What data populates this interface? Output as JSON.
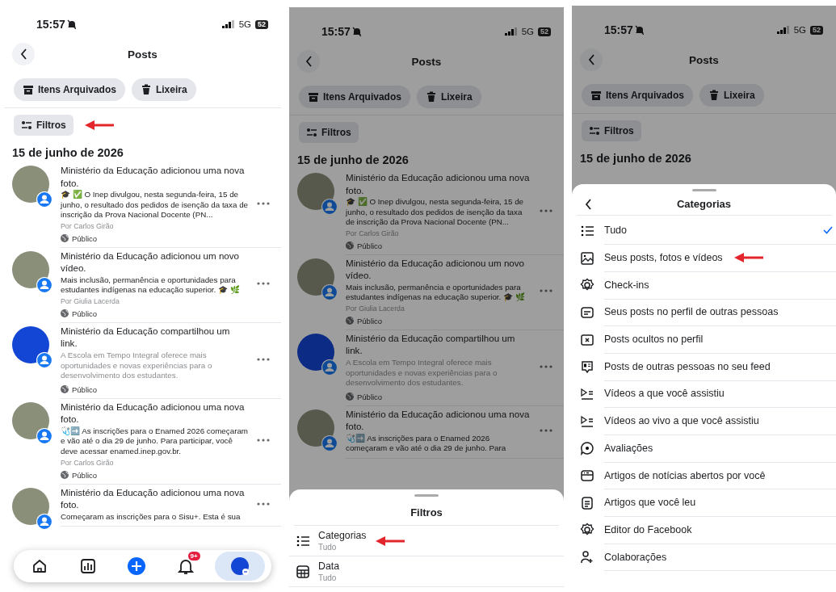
{
  "panels": [
    {
      "status": {
        "time": "15:57",
        "network": "5G",
        "battery": "52"
      },
      "header": {
        "title": "Posts"
      },
      "chips": [
        {
          "label": "Itens Arquivados"
        },
        {
          "label": "Lixeira"
        }
      ],
      "filter_button": {
        "label": "Filtros",
        "arrow": true
      },
      "date": "15 de junho de 2026",
      "posts": [
        {
          "kind": "post",
          "title": "Ministério da Educação adicionou uma nova foto.",
          "body": "🎓 ✅ O Inep divulgou, nesta segunda-feira, 15 de junho, o resultado dos pedidos de isenção da taxa de inscrição da Prova Nacional Docente (PN...",
          "author": "Por Carlos Girão",
          "audience": "Público"
        },
        {
          "kind": "post",
          "title": "Ministério da Educação adicionou um novo vídeo.",
          "body": "Mais inclusão, permanência e oportunidades para estudantes indígenas na educação superior. 🎓 🌿",
          "author": "Por Giulia Lacerda",
          "audience": "Público"
        },
        {
          "kind": "link",
          "title": "Ministério da Educação compartilhou um link.",
          "body": "A Escola em Tempo Integral oferece mais oportunidades e novas experiências para o desenvolvimento dos estudantes.",
          "audience": "Público"
        },
        {
          "kind": "post",
          "title": "Ministério da Educação adicionou uma nova foto.",
          "body": "🩺➡️ As inscrições para o Enamed 2026 começaram e vão até o dia 29 de junho. Para participar, você deve acessar enamed.inep.gov.br.",
          "author": "Por Carlos Girão",
          "audience": "Público"
        },
        {
          "kind": "post",
          "title": "Ministério da Educação adicionou uma nova foto.",
          "body": "Começaram as inscrições para o Sisu+. Esta é sua"
        }
      ],
      "nav": [
        {
          "selected": false
        },
        {
          "selected": false
        },
        {
          "selected": false
        },
        {
          "selected": false,
          "badge": "9+"
        },
        {
          "selected": true
        }
      ]
    },
    {
      "status": {
        "time": "15:57",
        "network": "5G",
        "battery": "52"
      },
      "header": {
        "title": "Posts"
      },
      "chips": [
        {
          "label": "Itens Arquivados"
        },
        {
          "label": "Lixeira"
        }
      ],
      "filter_button": {
        "label": "Filtros",
        "arrow": false
      },
      "date": "15 de junho de 2026",
      "posts": [
        {
          "kind": "post",
          "title": "Ministério da Educação adicionou uma nova foto.",
          "body": "🎓 ✅ O Inep divulgou, nesta segunda-feira, 15 de junho, o resultado dos pedidos de isenção da taxa de inscrição da Prova Nacional Docente (PN...",
          "author": "Por Carlos Girão",
          "audience": "Público"
        },
        {
          "kind": "post",
          "title": "Ministério da Educação adicionou um novo vídeo.",
          "body": "Mais inclusão, permanência e oportunidades para estudantes indígenas na educação superior. 🎓 🌿",
          "author": "Por Giulia Lacerda",
          "audience": "Público"
        },
        {
          "kind": "link",
          "title": "Ministério da Educação compartilhou um link.",
          "body": "A Escola em Tempo Integral oferece mais oportunidades e novas experiências para o desenvolvimento dos estudantes.",
          "audience": "Público"
        },
        {
          "kind": "post",
          "title": "Ministério da Educação adicionou uma nova foto.",
          "body": "🩺➡️ As inscrições para o Enamed 2026 começaram e vão até o dia 29 de junho. Para"
        }
      ],
      "sheet": {
        "kind": "filters",
        "title": "Filtros",
        "options": [
          {
            "label": "Categorias",
            "value": "Tudo",
            "arrow": true
          },
          {
            "label": "Data",
            "value": "Tudo",
            "arrow": false
          }
        ]
      }
    },
    {
      "status": {
        "time": "15:57",
        "network": "5G",
        "battery": "52"
      },
      "header": {
        "title": "Posts"
      },
      "chips": [
        {
          "label": "Itens Arquivados"
        },
        {
          "label": "Lixeira"
        }
      ],
      "filter_button": {
        "label": "Filtros",
        "arrow": false
      },
      "date": "15 de junho de 2026",
      "sheet": {
        "kind": "categories",
        "title": "Categorias",
        "options": [
          {
            "label": "Tudo",
            "selected": true,
            "arrow": false
          },
          {
            "label": "Seus posts, fotos e vídeos",
            "selected": false,
            "arrow": true
          },
          {
            "label": "Check-ins",
            "selected": false,
            "arrow": false
          },
          {
            "label": "Seus posts no perfil de outras pessoas",
            "selected": false,
            "arrow": false
          },
          {
            "label": "Posts ocultos no perfil",
            "selected": false,
            "arrow": false
          },
          {
            "label": "Posts de outras pessoas no seu feed",
            "selected": false,
            "arrow": false
          },
          {
            "label": "Vídeos a que você assistiu",
            "selected": false,
            "arrow": false
          },
          {
            "label": "Vídeos ao vivo a que você assistiu",
            "selected": false,
            "arrow": false
          },
          {
            "label": "Avaliações",
            "selected": false,
            "arrow": false
          },
          {
            "label": "Artigos de notícias abertos por você",
            "selected": false,
            "arrow": false
          },
          {
            "label": "Artigos que você leu",
            "selected": false,
            "arrow": false
          },
          {
            "label": "Editor do Facebook",
            "selected": false,
            "arrow": false
          },
          {
            "label": "Colaborações",
            "selected": false,
            "arrow": false
          }
        ]
      }
    }
  ]
}
